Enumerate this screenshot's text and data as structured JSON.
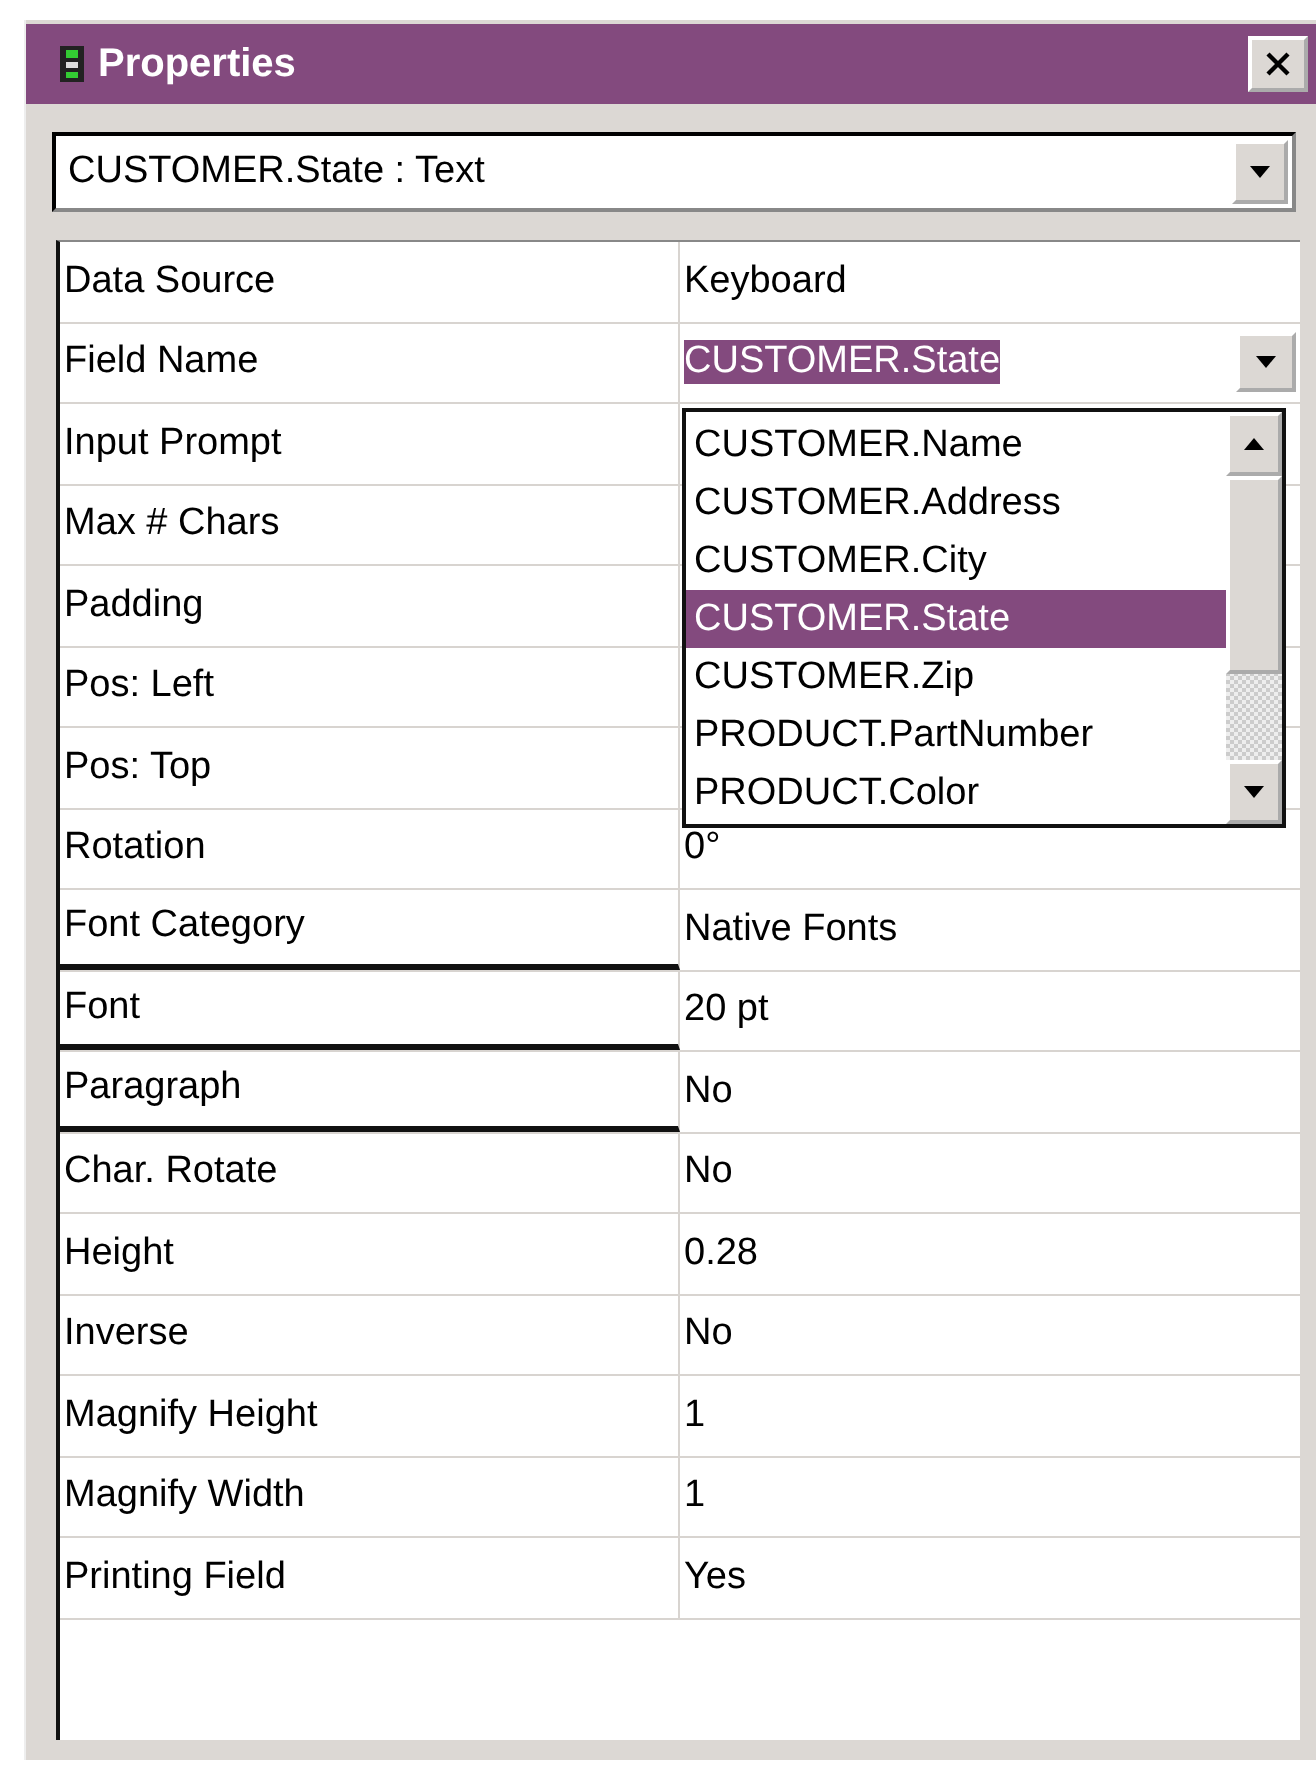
{
  "window": {
    "title": "Properties"
  },
  "object_selector": {
    "value": "CUSTOMER.State : Text"
  },
  "properties": [
    {
      "name": "Data Source",
      "kind": "text",
      "value": "Keyboard",
      "underlined": false
    },
    {
      "name": "Field Name",
      "kind": "combo",
      "value": "CUSTOMER.State",
      "underlined": false
    },
    {
      "name": "Input Prompt",
      "kind": "text",
      "underlined": false
    },
    {
      "name": "Max # Chars",
      "kind": "text",
      "underlined": false
    },
    {
      "name": "Padding",
      "kind": "text",
      "underlined": false
    },
    {
      "name": "Pos: Left",
      "kind": "text",
      "underlined": false
    },
    {
      "name": "Pos: Top",
      "kind": "text",
      "underlined": false
    },
    {
      "name": "Rotation",
      "kind": "text",
      "value": "0°",
      "underlined": false
    },
    {
      "name": "Font Category",
      "kind": "text",
      "value": "Native Fonts",
      "underlined": true
    },
    {
      "name": "Font",
      "kind": "text",
      "value": "20 pt",
      "underlined": true
    },
    {
      "name": "Paragraph",
      "kind": "text",
      "value": "No",
      "underlined": true
    },
    {
      "name": "Char. Rotate",
      "kind": "text",
      "value": "No",
      "underlined": false
    },
    {
      "name": "Height",
      "kind": "text",
      "value": "0.28",
      "underlined": false
    },
    {
      "name": "Inverse",
      "kind": "text",
      "value": "No",
      "underlined": false
    },
    {
      "name": "Magnify Height",
      "kind": "text",
      "value": "1",
      "underlined": false
    },
    {
      "name": "Magnify Width",
      "kind": "text",
      "value": "1",
      "underlined": false
    },
    {
      "name": "Printing Field",
      "kind": "text",
      "value": "Yes",
      "underlined": false
    }
  ],
  "field_list": {
    "items": [
      {
        "label": "CUSTOMER.Name",
        "selected": false
      },
      {
        "label": "CUSTOMER.Address",
        "selected": false
      },
      {
        "label": "CUSTOMER.City",
        "selected": false
      },
      {
        "label": "CUSTOMER.State",
        "selected": true
      },
      {
        "label": "CUSTOMER.Zip",
        "selected": false
      },
      {
        "label": "PRODUCT.PartNumber",
        "selected": false
      },
      {
        "label": "PRODUCT.Color",
        "selected": false
      }
    ]
  }
}
